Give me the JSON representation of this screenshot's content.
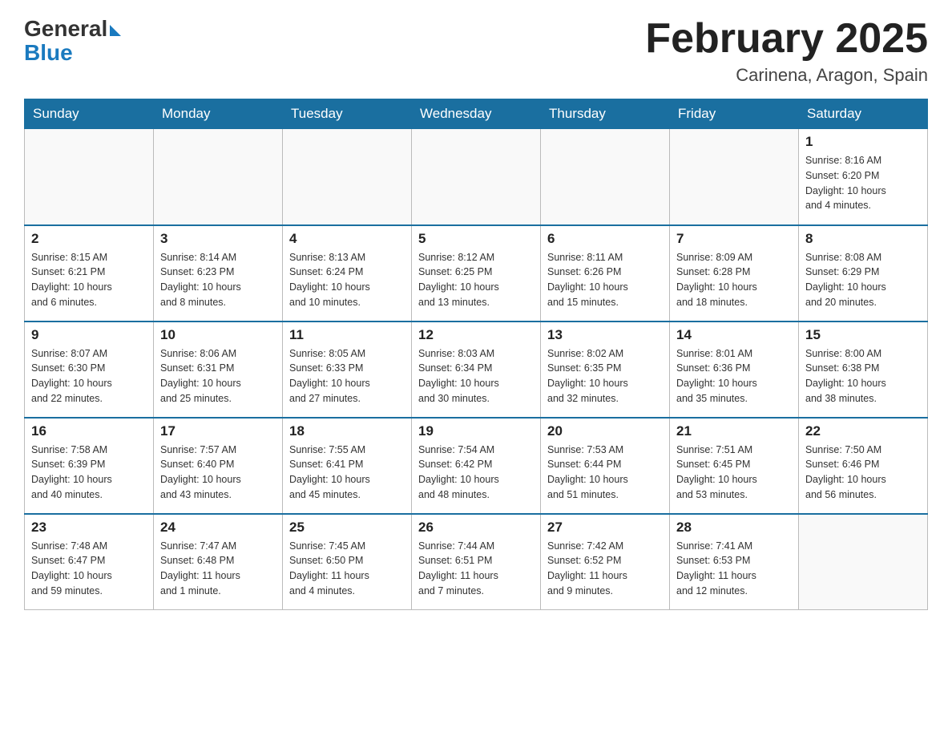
{
  "header": {
    "logo_general": "General",
    "logo_blue": "Blue",
    "month_title": "February 2025",
    "location": "Carinena, Aragon, Spain"
  },
  "weekdays": [
    "Sunday",
    "Monday",
    "Tuesday",
    "Wednesday",
    "Thursday",
    "Friday",
    "Saturday"
  ],
  "weeks": [
    [
      {
        "day": "",
        "info": ""
      },
      {
        "day": "",
        "info": ""
      },
      {
        "day": "",
        "info": ""
      },
      {
        "day": "",
        "info": ""
      },
      {
        "day": "",
        "info": ""
      },
      {
        "day": "",
        "info": ""
      },
      {
        "day": "1",
        "info": "Sunrise: 8:16 AM\nSunset: 6:20 PM\nDaylight: 10 hours\nand 4 minutes."
      }
    ],
    [
      {
        "day": "2",
        "info": "Sunrise: 8:15 AM\nSunset: 6:21 PM\nDaylight: 10 hours\nand 6 minutes."
      },
      {
        "day": "3",
        "info": "Sunrise: 8:14 AM\nSunset: 6:23 PM\nDaylight: 10 hours\nand 8 minutes."
      },
      {
        "day": "4",
        "info": "Sunrise: 8:13 AM\nSunset: 6:24 PM\nDaylight: 10 hours\nand 10 minutes."
      },
      {
        "day": "5",
        "info": "Sunrise: 8:12 AM\nSunset: 6:25 PM\nDaylight: 10 hours\nand 13 minutes."
      },
      {
        "day": "6",
        "info": "Sunrise: 8:11 AM\nSunset: 6:26 PM\nDaylight: 10 hours\nand 15 minutes."
      },
      {
        "day": "7",
        "info": "Sunrise: 8:09 AM\nSunset: 6:28 PM\nDaylight: 10 hours\nand 18 minutes."
      },
      {
        "day": "8",
        "info": "Sunrise: 8:08 AM\nSunset: 6:29 PM\nDaylight: 10 hours\nand 20 minutes."
      }
    ],
    [
      {
        "day": "9",
        "info": "Sunrise: 8:07 AM\nSunset: 6:30 PM\nDaylight: 10 hours\nand 22 minutes."
      },
      {
        "day": "10",
        "info": "Sunrise: 8:06 AM\nSunset: 6:31 PM\nDaylight: 10 hours\nand 25 minutes."
      },
      {
        "day": "11",
        "info": "Sunrise: 8:05 AM\nSunset: 6:33 PM\nDaylight: 10 hours\nand 27 minutes."
      },
      {
        "day": "12",
        "info": "Sunrise: 8:03 AM\nSunset: 6:34 PM\nDaylight: 10 hours\nand 30 minutes."
      },
      {
        "day": "13",
        "info": "Sunrise: 8:02 AM\nSunset: 6:35 PM\nDaylight: 10 hours\nand 32 minutes."
      },
      {
        "day": "14",
        "info": "Sunrise: 8:01 AM\nSunset: 6:36 PM\nDaylight: 10 hours\nand 35 minutes."
      },
      {
        "day": "15",
        "info": "Sunrise: 8:00 AM\nSunset: 6:38 PM\nDaylight: 10 hours\nand 38 minutes."
      }
    ],
    [
      {
        "day": "16",
        "info": "Sunrise: 7:58 AM\nSunset: 6:39 PM\nDaylight: 10 hours\nand 40 minutes."
      },
      {
        "day": "17",
        "info": "Sunrise: 7:57 AM\nSunset: 6:40 PM\nDaylight: 10 hours\nand 43 minutes."
      },
      {
        "day": "18",
        "info": "Sunrise: 7:55 AM\nSunset: 6:41 PM\nDaylight: 10 hours\nand 45 minutes."
      },
      {
        "day": "19",
        "info": "Sunrise: 7:54 AM\nSunset: 6:42 PM\nDaylight: 10 hours\nand 48 minutes."
      },
      {
        "day": "20",
        "info": "Sunrise: 7:53 AM\nSunset: 6:44 PM\nDaylight: 10 hours\nand 51 minutes."
      },
      {
        "day": "21",
        "info": "Sunrise: 7:51 AM\nSunset: 6:45 PM\nDaylight: 10 hours\nand 53 minutes."
      },
      {
        "day": "22",
        "info": "Sunrise: 7:50 AM\nSunset: 6:46 PM\nDaylight: 10 hours\nand 56 minutes."
      }
    ],
    [
      {
        "day": "23",
        "info": "Sunrise: 7:48 AM\nSunset: 6:47 PM\nDaylight: 10 hours\nand 59 minutes."
      },
      {
        "day": "24",
        "info": "Sunrise: 7:47 AM\nSunset: 6:48 PM\nDaylight: 11 hours\nand 1 minute."
      },
      {
        "day": "25",
        "info": "Sunrise: 7:45 AM\nSunset: 6:50 PM\nDaylight: 11 hours\nand 4 minutes."
      },
      {
        "day": "26",
        "info": "Sunrise: 7:44 AM\nSunset: 6:51 PM\nDaylight: 11 hours\nand 7 minutes."
      },
      {
        "day": "27",
        "info": "Sunrise: 7:42 AM\nSunset: 6:52 PM\nDaylight: 11 hours\nand 9 minutes."
      },
      {
        "day": "28",
        "info": "Sunrise: 7:41 AM\nSunset: 6:53 PM\nDaylight: 11 hours\nand 12 minutes."
      },
      {
        "day": "",
        "info": ""
      }
    ]
  ]
}
